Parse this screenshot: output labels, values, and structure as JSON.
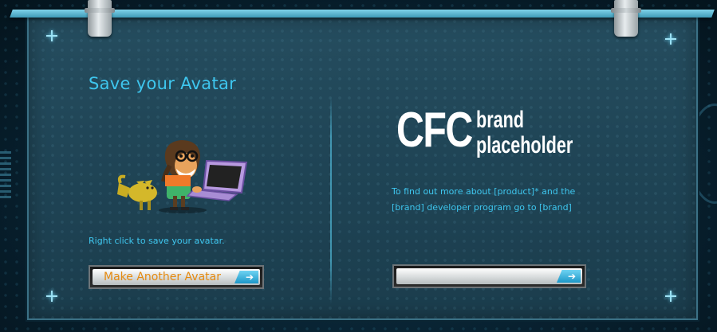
{
  "panel": {
    "title": "Save your Avatar",
    "caption": "Right click to save your avatar.",
    "make_another_label": "Make Another Avatar",
    "url_field_value": ""
  },
  "brand": {
    "logo_main": "CFC",
    "logo_line1": "brand",
    "logo_line2": "placeholder",
    "info_line1": "To find out more about [product]* and the",
    "info_line2": "[brand] developer program go to [brand]"
  },
  "icons": {
    "button_arrow": "arrow-right-icon",
    "corner_marker": "plus-icon"
  },
  "colors": {
    "accent_text": "#3ec6ee",
    "button_label": "#e58a10",
    "panel_bg": "#1f4455",
    "logo_text": "#ffffff"
  }
}
